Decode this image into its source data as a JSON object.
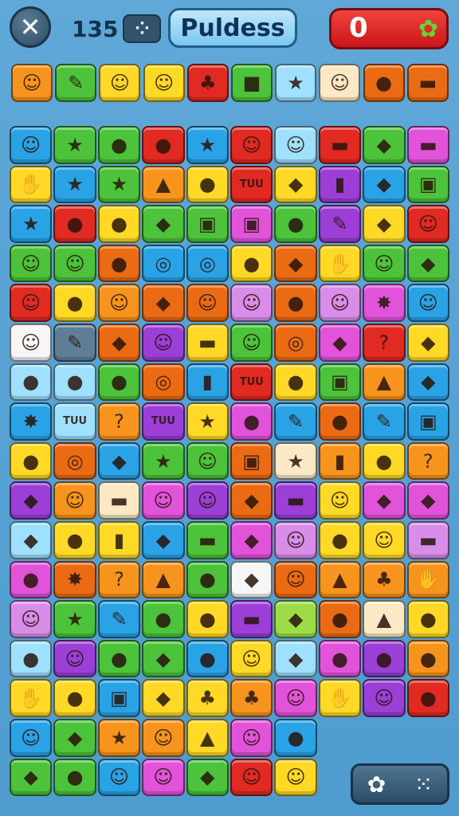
{
  "header": {
    "close_icon": "close-x-icon",
    "moves_count": "135",
    "dice_icon": "dice-icon",
    "title": "Puldess",
    "score": "0",
    "score_icon": "flower-icon"
  },
  "palette": {
    "orange": "#f7941d",
    "green": "#4cc33a",
    "red": "#e02a22",
    "yellow": "#ffd925",
    "blue": "#2aa3e6",
    "purple": "#9b3fd6",
    "magenta": "#e154d9",
    "cream": "#fbe9c6",
    "lightblue": "#9fe0ff",
    "lime": "#9ddc47",
    "lilac": "#d88ee8",
    "darkorange": "#ea6b14",
    "white": "#f6f6f6",
    "slate": "#5f7e96",
    "pink": "#f5a6d9"
  },
  "inventory": [
    {
      "bg": "orange",
      "glyph": "☺"
    },
    {
      "bg": "green",
      "glyph": "✎"
    },
    {
      "bg": "yellow",
      "glyph": "☺"
    },
    {
      "bg": "yellow",
      "glyph": "☺"
    },
    {
      "bg": "red",
      "glyph": "♣"
    },
    {
      "bg": "green",
      "glyph": "■"
    },
    {
      "bg": "lightblue",
      "glyph": "★"
    },
    {
      "bg": "cream",
      "glyph": "☺"
    },
    {
      "bg": "darkorange",
      "glyph": "●"
    },
    {
      "bg": "darkorange",
      "glyph": "▬"
    }
  ],
  "board": {
    "rows": [
      [
        [
          "blue",
          "☺"
        ],
        [
          "green",
          "★"
        ],
        [
          "green",
          "●"
        ],
        [
          "red",
          "●"
        ],
        [
          "blue",
          "★"
        ],
        [
          "red",
          "☺"
        ],
        [
          "lightblue",
          "☺"
        ],
        [
          "red",
          "▬"
        ],
        [
          "green",
          "◆"
        ],
        [
          "magenta",
          "▬"
        ]
      ],
      [
        [
          "yellow",
          "✋"
        ],
        [
          "blue",
          "★"
        ],
        [
          "green",
          "★"
        ],
        [
          "orange",
          "▲"
        ],
        [
          "yellow",
          "●"
        ],
        [
          "red",
          "TUU"
        ],
        [
          "yellow",
          "◆"
        ],
        [
          "purple",
          "▮"
        ],
        [
          "blue",
          "◆"
        ],
        [
          "green",
          "▣"
        ]
      ],
      [
        [
          "blue",
          "★"
        ],
        [
          "red",
          "●"
        ],
        [
          "yellow",
          "●"
        ],
        [
          "green",
          "◆"
        ],
        [
          "green",
          "▣"
        ],
        [
          "magenta",
          "▣"
        ],
        [
          "green",
          "●"
        ],
        [
          "purple",
          "✎"
        ],
        [
          "yellow",
          "◆"
        ],
        [
          "red",
          "☺"
        ]
      ],
      [
        [
          "green",
          "☺"
        ],
        [
          "green",
          "☺"
        ],
        [
          "darkorange",
          "●"
        ],
        [
          "blue",
          "◎"
        ],
        [
          "blue",
          "◎"
        ],
        [
          "yellow",
          "●"
        ],
        [
          "darkorange",
          "◆"
        ],
        [
          "yellow",
          "✋"
        ],
        [
          "green",
          "☺"
        ],
        [
          "green",
          "◆"
        ]
      ],
      [
        [
          "red",
          "☺"
        ],
        [
          "yellow",
          "●"
        ],
        [
          "orange",
          "☺"
        ],
        [
          "darkorange",
          "◆"
        ],
        [
          "darkorange",
          "☺"
        ],
        [
          "lilac",
          "☺"
        ],
        [
          "darkorange",
          "●"
        ],
        [
          "lilac",
          "☺"
        ],
        [
          "magenta",
          "✸"
        ],
        [
          "blue",
          "☺"
        ]
      ],
      [
        [
          "white",
          "☺"
        ],
        [
          "slate",
          "✎"
        ],
        [
          "darkorange",
          "◆"
        ],
        [
          "purple",
          "☺"
        ],
        [
          "yellow",
          "▬"
        ],
        [
          "green",
          "☺"
        ],
        [
          "darkorange",
          "◎"
        ],
        [
          "magenta",
          "◆"
        ],
        [
          "red",
          "?"
        ],
        [
          "yellow",
          "◆"
        ]
      ],
      [
        [
          "lightblue",
          "●"
        ],
        [
          "lightblue",
          "●"
        ],
        [
          "green",
          "●"
        ],
        [
          "darkorange",
          "◎"
        ],
        [
          "blue",
          "▮"
        ],
        [
          "red",
          "TUU"
        ],
        [
          "yellow",
          "●"
        ],
        [
          "green",
          "▣"
        ],
        [
          "orange",
          "▲"
        ],
        [
          "blue",
          "◆"
        ]
      ],
      [
        [
          "blue",
          "✸"
        ],
        [
          "lightblue",
          "TUU"
        ],
        [
          "orange",
          "?"
        ],
        [
          "purple",
          "TUU"
        ],
        [
          "yellow",
          "★"
        ],
        [
          "magenta",
          "●"
        ],
        [
          "blue",
          "✎"
        ],
        [
          "darkorange",
          "●"
        ],
        [
          "blue",
          "✎"
        ],
        [
          "blue",
          "▣"
        ]
      ],
      [
        [
          "yellow",
          "●"
        ],
        [
          "darkorange",
          "◎"
        ],
        [
          "blue",
          "◆"
        ],
        [
          "green",
          "★"
        ],
        [
          "green",
          "☺"
        ],
        [
          "darkorange",
          "▣"
        ],
        [
          "cream",
          "★"
        ],
        [
          "orange",
          "▮"
        ],
        [
          "yellow",
          "●"
        ],
        [
          "orange",
          "?"
        ]
      ],
      [
        [
          "purple",
          "◆"
        ],
        [
          "orange",
          "☺"
        ],
        [
          "cream",
          "▬"
        ],
        [
          "magenta",
          "☺"
        ],
        [
          "purple",
          "☺"
        ],
        [
          "darkorange",
          "◆"
        ],
        [
          "purple",
          "▬"
        ],
        [
          "yellow",
          "☺"
        ],
        [
          "magenta",
          "◆"
        ],
        [
          "magenta",
          "◆"
        ]
      ],
      [
        [
          "lightblue",
          "◆"
        ],
        [
          "yellow",
          "●"
        ],
        [
          "yellow",
          "▮"
        ],
        [
          "blue",
          "◆"
        ],
        [
          "green",
          "▬"
        ],
        [
          "magenta",
          "◆"
        ],
        [
          "lilac",
          "☺"
        ],
        [
          "yellow",
          "●"
        ],
        [
          "yellow",
          "☺"
        ],
        [
          "lilac",
          "▬"
        ]
      ],
      [
        [
          "magenta",
          "●"
        ],
        [
          "darkorange",
          "✸"
        ],
        [
          "orange",
          "?"
        ],
        [
          "orange",
          "▲"
        ],
        [
          "green",
          "●"
        ],
        [
          "white",
          "◆"
        ],
        [
          "darkorange",
          "☺"
        ],
        [
          "orange",
          "▲"
        ],
        [
          "orange",
          "♣"
        ],
        [
          "orange",
          "✋"
        ]
      ],
      [
        [
          "lilac",
          "☺"
        ],
        [
          "green",
          "★"
        ],
        [
          "blue",
          "✎"
        ],
        [
          "green",
          "●"
        ],
        [
          "yellow",
          "●"
        ],
        [
          "purple",
          "▬"
        ],
        [
          "lime",
          "◆"
        ],
        [
          "darkorange",
          "●"
        ],
        [
          "cream",
          "▲"
        ],
        [
          "yellow",
          "●"
        ]
      ],
      [
        [
          "lightblue",
          "●"
        ],
        [
          "purple",
          "☺"
        ],
        [
          "green",
          "●"
        ],
        [
          "green",
          "◆"
        ],
        [
          "blue",
          "●"
        ],
        [
          "yellow",
          "☺"
        ],
        [
          "lightblue",
          "◆"
        ],
        [
          "magenta",
          "●"
        ],
        [
          "purple",
          "●"
        ],
        [
          "orange",
          "●"
        ]
      ],
      [
        [
          "yellow",
          "✋"
        ],
        [
          "yellow",
          "●"
        ],
        [
          "blue",
          "▣"
        ],
        [
          "yellow",
          "◆"
        ],
        [
          "yellow",
          "♣"
        ],
        [
          "orange",
          "♣"
        ],
        [
          "magenta",
          "☺"
        ],
        [
          "yellow",
          "✋"
        ],
        [
          "purple",
          "☺"
        ],
        [
          "red",
          "●"
        ]
      ],
      [
        [
          "blue",
          "☺"
        ],
        [
          "green",
          "◆"
        ],
        [
          "orange",
          "★"
        ],
        [
          "orange",
          "☺"
        ],
        [
          "yellow",
          "▲"
        ],
        [
          "magenta",
          "☺"
        ],
        [
          "blue",
          "●"
        ],
        null,
        null,
        null
      ],
      [
        [
          "green",
          "◆"
        ],
        [
          "green",
          "●"
        ],
        [
          "blue",
          "☺"
        ],
        [
          "magenta",
          "☺"
        ],
        [
          "green",
          "◆"
        ],
        [
          "red",
          "☺"
        ],
        [
          "yellow",
          "☺"
        ],
        null,
        null,
        null
      ]
    ]
  },
  "bottom": {
    "settings_icon": "gear-icon",
    "dice_icon": "dice-icon"
  }
}
